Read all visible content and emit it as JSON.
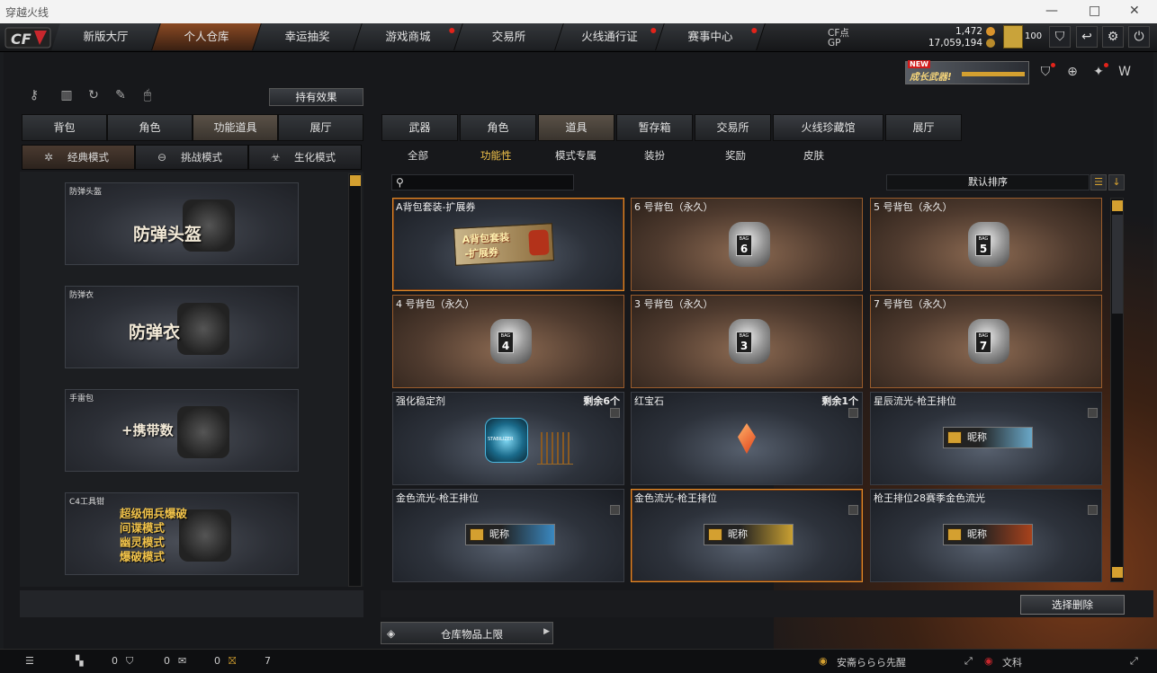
{
  "window": {
    "title": "穿越火线",
    "controls": [
      "—",
      "□",
      "✕"
    ]
  },
  "nav": {
    "tabs": [
      {
        "label": "新版大厅",
        "dot": false,
        "active": false
      },
      {
        "label": "个人仓库",
        "dot": false,
        "active": true
      },
      {
        "label": "幸运抽奖",
        "dot": false,
        "active": false
      },
      {
        "label": "游戏商城",
        "dot": true,
        "active": false
      },
      {
        "label": "交易所",
        "dot": false,
        "active": false
      },
      {
        "label": "火线通行证",
        "dot": true,
        "active": false
      },
      {
        "label": "赛事中心",
        "dot": true,
        "active": false
      }
    ]
  },
  "currency": {
    "cf_label": "CF点",
    "cf_value": "1,472",
    "gp_label": "GP",
    "gp_value": "17,059,194"
  },
  "rank": {
    "value": "100"
  },
  "banner": {
    "new_tag": "NEW",
    "text": "成长武器!"
  },
  "left": {
    "effects_button": "持有效果",
    "tabs": [
      "背包",
      "角色",
      "功能道具",
      "展厅"
    ],
    "active_tab": 2,
    "modes": [
      {
        "label": "经典模式",
        "icon": "✲",
        "active": true
      },
      {
        "label": "挑战模式",
        "icon": "⊖",
        "active": false
      },
      {
        "label": "生化模式",
        "icon": "☣",
        "active": false
      }
    ],
    "items": [
      {
        "small": "防弹头盔",
        "big": "防弹头盔"
      },
      {
        "small": "防弹衣",
        "big": "防弹衣"
      },
      {
        "small": "手雷包",
        "big": "+携带数"
      },
      {
        "small": "C4工具钳",
        "lines": [
          "超级佣兵爆破",
          "间谍模式",
          "幽灵模式",
          "爆破模式"
        ]
      }
    ]
  },
  "right": {
    "tabs": [
      "武器",
      "角色",
      "道具",
      "暂存箱",
      "交易所",
      "火线珍藏馆",
      "展厅"
    ],
    "active_tab": 2,
    "subtabs": [
      "全部",
      "功能性",
      "模式专属",
      "装扮",
      "奖励",
      "皮肤"
    ],
    "active_subtab": 1,
    "search_placeholder": "",
    "sort_label": "默认排序",
    "sort_icons": [
      "☰",
      "↓"
    ],
    "items": [
      {
        "name": "A背包套装-扩展券",
        "style": "blue",
        "selected": true,
        "type": "ticket",
        "ticket_lines": [
          "A背包套装",
          "-扩展券"
        ]
      },
      {
        "name": "6 号背包（永久）",
        "style": "brown",
        "type": "bag",
        "bag_label": "BAG",
        "bag_no": "6"
      },
      {
        "name": "5 号背包（永久）",
        "style": "brown",
        "type": "bag",
        "bag_label": "BAG",
        "bag_no": "5"
      },
      {
        "name": "4 号背包（永久）",
        "style": "brown",
        "type": "bag",
        "bag_label": "BAG",
        "bag_no": "4"
      },
      {
        "name": "3 号背包（永久）",
        "style": "brown",
        "type": "bag",
        "bag_label": "BAG",
        "bag_no": "3"
      },
      {
        "name": "7 号背包（永久）",
        "style": "brown",
        "type": "bag",
        "bag_label": "BAG",
        "bag_no": "7"
      },
      {
        "name": "强化稳定剂",
        "style": "blue",
        "type": "jar",
        "remain": "剩余6个",
        "jar_label": "STABILIZER"
      },
      {
        "name": "红宝石",
        "style": "blue",
        "type": "gem",
        "remain": "剩余1个"
      },
      {
        "name": "星辰流光-枪王排位",
        "style": "blue",
        "type": "plate",
        "plate": "昵称",
        "plate_color": "#6aa8c8"
      },
      {
        "name": "金色流光-枪王排位",
        "style": "blue",
        "type": "plate",
        "plate": "昵称",
        "plate_color": "#3a88c0"
      },
      {
        "name": "金色流光-枪王排位",
        "style": "blue",
        "selected": true,
        "type": "plate",
        "plate": "昵称",
        "plate_color": "#c9a032"
      },
      {
        "name": "枪王排位28赛季金色流光",
        "style": "blue",
        "type": "plate",
        "plate": "昵称",
        "plate_color": "#a8421c"
      }
    ],
    "delete_button": "选择删除",
    "storage_label": "仓库物品上限"
  },
  "status": {
    "count1": "0",
    "count2": "0",
    "count3": "0",
    "count4": "7",
    "user": "安斋ららら先醒",
    "user2": "文科"
  },
  "colors": {
    "accent": "#d4a030",
    "active_tab": "#8a4a24",
    "alert": "#e2231a"
  }
}
